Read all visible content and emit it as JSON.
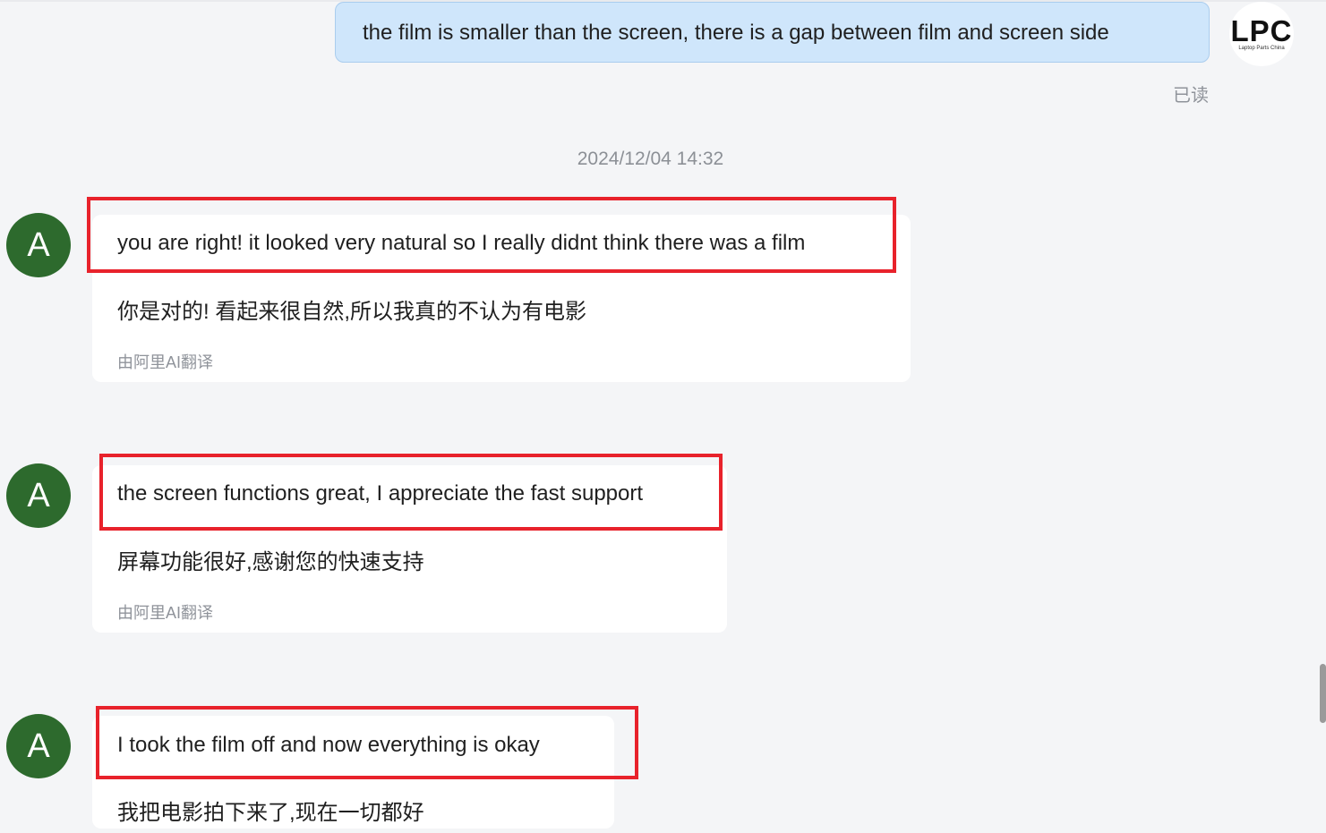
{
  "outgoing": {
    "text": "the film is smaller than the screen, there is a gap between film and screen side",
    "avatar_logo": "LPC",
    "avatar_caption": "Laptop Parts China",
    "read_status": "已读"
  },
  "timestamp": "2024/12/04 14:32",
  "incoming": [
    {
      "avatar": "A",
      "text": "you are right! it looked very natural so I really didnt think there was a film",
      "translation": "你是对的! 看起来很自然,所以我真的不认为有电影",
      "note": "由阿里AI翻译"
    },
    {
      "avatar": "A",
      "text": "the screen functions great, I appreciate the fast support",
      "translation": "屏幕功能很好,感谢您的快速支持",
      "note": "由阿里AI翻译"
    },
    {
      "avatar": "A",
      "text": "I took the film off and now everything is okay",
      "translation": "我把电影拍下来了,现在一切都好"
    }
  ],
  "colors": {
    "outgoing_bubble": "#cfe6fb",
    "incoming_avatar": "#2d6a2d",
    "highlight": "#e8222b",
    "logo_dark": "#111111",
    "logo_red": "#e8222b"
  }
}
